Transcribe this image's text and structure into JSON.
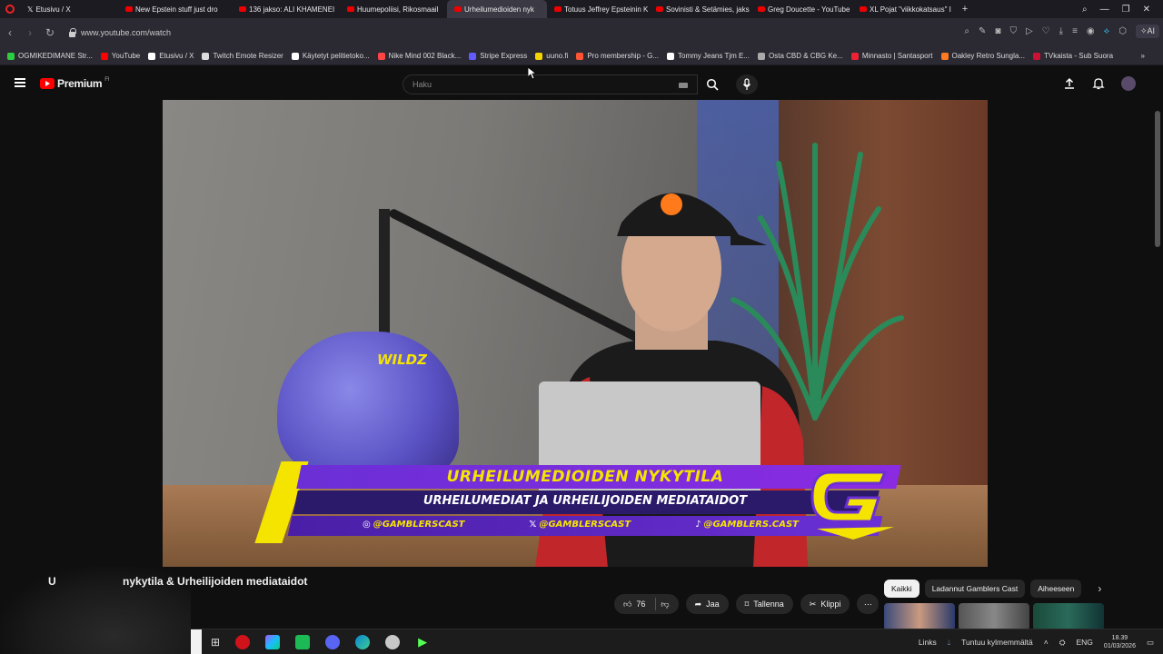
{
  "browser": {
    "tabs": [
      {
        "label": "Etusivu / X",
        "type": "x"
      },
      {
        "label": "New Epstein stuff just dro",
        "type": "yt"
      },
      {
        "label": "136 jakso: ALI KHAMENEI",
        "type": "yt"
      },
      {
        "label": "Huumepoliisi, Rikosmaail",
        "type": "yt"
      },
      {
        "label": "Urheilumedioiden nyk",
        "type": "yt",
        "active": true
      },
      {
        "label": "Totuus Jeffrey Epsteinin K",
        "type": "yt"
      },
      {
        "label": "Sovinisti & Setämies, jaks",
        "type": "yt"
      },
      {
        "label": "Greg Doucette - YouTube",
        "type": "yt"
      },
      {
        "label": "XL Pojat \"viikkokatsaus\" I",
        "type": "yt"
      }
    ],
    "new_tab": "+",
    "url": "www.youtube.com/watch",
    "ai_label": "AI",
    "bookmarks": [
      {
        "label": "OGMIKEDIMANE Str...",
        "color": "#2ecc40"
      },
      {
        "label": "YouTube",
        "color": "#ff0000"
      },
      {
        "label": "Etusivu / X",
        "color": "#ffffff"
      },
      {
        "label": "Twitch Emote Resizer",
        "color": "#dddddd"
      },
      {
        "label": "Käytetyt pelitietoko...",
        "color": "#ffffff"
      },
      {
        "label": "Nike Mind 002 Black...",
        "color": "#ff4444"
      },
      {
        "label": "Stripe Express",
        "color": "#635bff"
      },
      {
        "label": "uuno.fi",
        "color": "#f5d400"
      },
      {
        "label": "Pro membership - G...",
        "color": "#ff5533"
      },
      {
        "label": "Tommy Jeans Tjm E...",
        "color": "#ffffff"
      },
      {
        "label": "Osta CBD & CBG Ke...",
        "color": "#aaaaaa"
      },
      {
        "label": "Minnasto | Santasport",
        "color": "#ee2233"
      },
      {
        "label": "Oakley Retro Sunglа...",
        "color": "#ff7a22"
      },
      {
        "label": "TVkaista - Sub Suora",
        "color": "#cc1133"
      }
    ]
  },
  "youtube": {
    "logo_word": "Premium",
    "logo_region": "FI",
    "search_placeholder": "Haku",
    "video": {
      "lower_third_title": "URHEILUMEDIOIDEN NYKYTILA",
      "lower_third_subtitle": "URHEILUMEDIAT JA URHEILIJOIDEN MEDIATAIDOT",
      "social_instagram": "@GAMBLERSCAST",
      "social_x": "@GAMBLERSCAST",
      "social_tiktok": "@GAMBLERS.CAST",
      "helmet_text": "WILDZ"
    },
    "title_visible": "nykytila & Urheilijoiden mediataidot",
    "title_prefix": "U",
    "actions": {
      "likes": "76",
      "share": "Jaa",
      "save": "Tallenna",
      "clip": "Klippi"
    },
    "chips": [
      "Kaikki",
      "Ladannut Gamblers Cast",
      "Aiheeseen"
    ]
  },
  "taskbar": {
    "links_label": "Links",
    "weather": "Tuntuu kylmemmältä",
    "lang": "ENG",
    "time": "18.39",
    "date": "01/03/2026"
  },
  "colors": {
    "accent_yellow": "#f5e400",
    "accent_purple": "#6b2fd6",
    "yt_red": "#ff0000"
  }
}
